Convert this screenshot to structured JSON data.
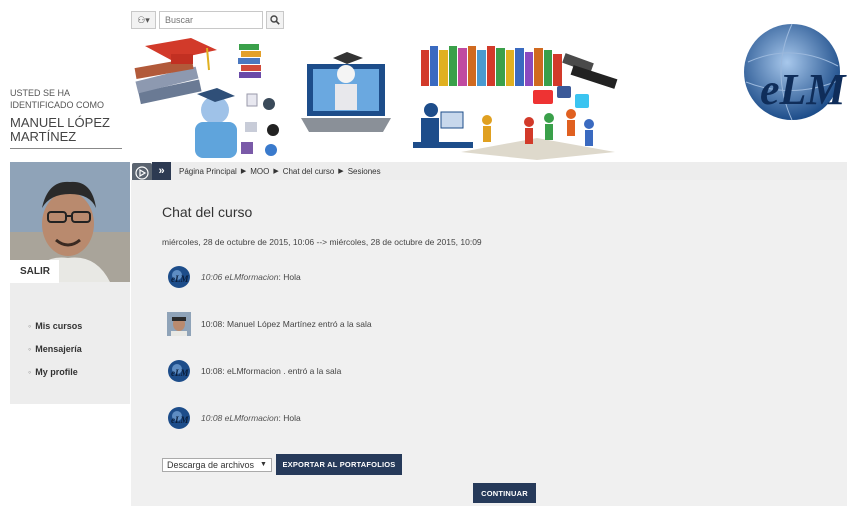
{
  "search": {
    "placeholder": "Buscar",
    "value": ""
  },
  "identity": {
    "intro": "USTED SE HA\nIDENTIFICADO COMO",
    "name": "MANUEL LÓPEZ\nMARTÍNEZ"
  },
  "sidebar": {
    "logout_label": "SALIR",
    "nav": [
      "Mis cursos",
      "Mensajería",
      "My profile"
    ]
  },
  "breadcrumb": {
    "toggle": "»",
    "items": [
      "Página Principal",
      "MOO",
      "Chat del curso",
      "Sesiones"
    ]
  },
  "main": {
    "title": "Chat del curso",
    "session_range": "miércoles, 28 de octubre de 2015, 10:06 --> miércoles, 28 de octubre de 2015, 10:09",
    "messages": [
      {
        "time": "10:06 eLMformacion",
        "text": ": Hola"
      },
      {
        "time": "",
        "text": "10:08: Manuel López Martínez entró a la sala"
      },
      {
        "time": "",
        "text": "10:08: eLMformacion . entró a la sala"
      },
      {
        "time": "10:08 eLMformacion",
        "text": ": Hola"
      }
    ],
    "download_select": "Descarga de archivos",
    "export_label": "EXPORTAR AL PORTAFOLIOS",
    "continue_label": "CONTINUAR"
  },
  "logo": {
    "text": "eLM"
  },
  "colors": {
    "accent": "#263a5a",
    "panel": "#f0f0f0",
    "sidebar": "#ededed"
  }
}
